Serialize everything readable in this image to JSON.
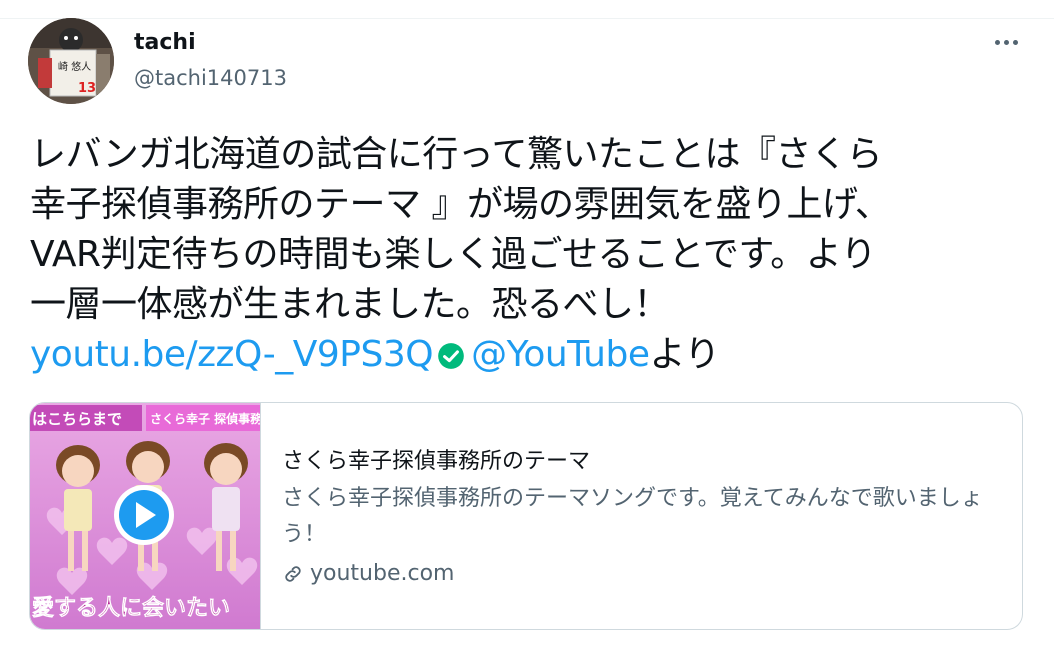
{
  "author": {
    "name": "tachi",
    "handle": "@tachi140713"
  },
  "tweet": {
    "lines": [
      "レバンガ北海道の試合に行って驚いたことは『さくら",
      "幸子探偵事務所のテーマ 』が場の雰囲気を盛り上げ、",
      "VAR判定待ちの時間も楽しく過ごせることです。より",
      "一層一体感が生まれました。恐るべし！"
    ],
    "link_text": "youtu.be/zzQ-_V9PS3Q",
    "mention": "@YouTube",
    "suffix": "より"
  },
  "card": {
    "title": "さくら幸子探偵事務所のテーマ",
    "description": "さくら幸子探偵事務所のテーマソングです。覚えてみんなで歌いましょう！",
    "domain": "youtube.com",
    "thumb_top_left": "はこちらまで",
    "thumb_top_right": "さくら幸子 探偵事務",
    "thumb_bottom": "愛する人に会いたい"
  },
  "avatar": {
    "sign_text": "崎 悠人",
    "number": "13"
  },
  "colors": {
    "accent": "#1d9bf0",
    "text": "#0f1419",
    "muted": "#536471",
    "border": "#cfd9de",
    "verified": "#00ba7c",
    "thumb_bg": "#d98bd8"
  },
  "icons": [
    "more-icon",
    "verified-icon",
    "link-icon",
    "play-icon"
  ]
}
